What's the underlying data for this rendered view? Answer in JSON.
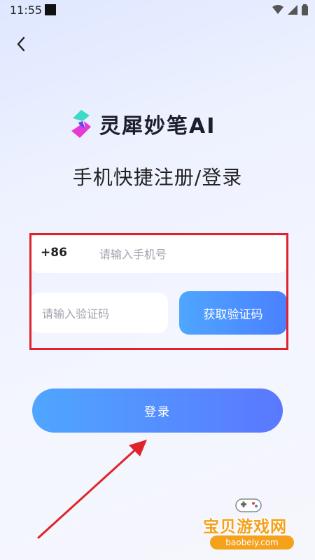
{
  "status_bar": {
    "time": "11:55"
  },
  "header": {
    "back_icon": "chevron-left-icon"
  },
  "brand": {
    "name": "灵犀妙笔AI",
    "icon": "lingxi-logo-icon"
  },
  "title": "手机快捷注册/登录",
  "phone": {
    "prefix": "+86",
    "placeholder": "请输入手机号",
    "value": ""
  },
  "code": {
    "placeholder": "请输入验证码",
    "value": "",
    "button_label": "获取验证码"
  },
  "login": {
    "button_label": "登录"
  },
  "watermark": {
    "text": "宝贝游戏网",
    "url": "baobeiy.com"
  },
  "colors": {
    "accent_start": "#4fa6ff",
    "accent_end": "#5a78ff",
    "highlight": "#e0232a",
    "watermark": "#f4a11c"
  }
}
